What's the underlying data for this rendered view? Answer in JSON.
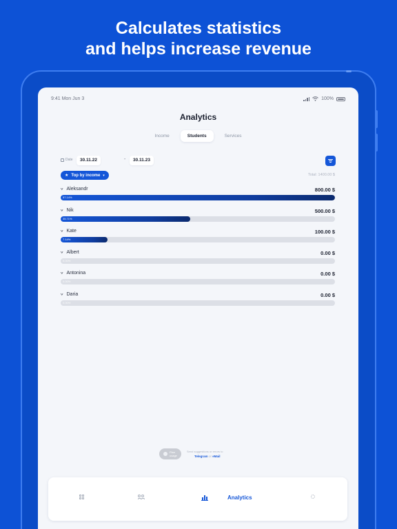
{
  "headline": {
    "line1": "Calculates statistics",
    "line2": "and helps increase revenue"
  },
  "colors": {
    "brand_blue": "#0d52d6",
    "accent": "#1456d8",
    "bar_dark": "#0b2a6e",
    "track": "#dcdfe6",
    "screen_bg": "#f4f6fa"
  },
  "status_bar": {
    "time": "9:41 Mon Jun 3",
    "battery": "100%",
    "icons": [
      "signal-icon",
      "wifi-icon",
      "battery-icon"
    ]
  },
  "page": {
    "title": "Analytics"
  },
  "tabs": [
    {
      "label": "Income",
      "active": false
    },
    {
      "label": "Students",
      "active": true
    },
    {
      "label": "Services",
      "active": false
    }
  ],
  "filters": {
    "date_label": "Date",
    "date_from": "30.11.22",
    "date_separator": "-",
    "date_to": "30.11.23",
    "filter_icon": "filter-icon"
  },
  "sort": {
    "label": "Top by income",
    "icon": "star-icon",
    "chevron": "chevron-down-icon"
  },
  "total": "Total: 1400.00 $",
  "students": [
    {
      "name": "Aleksandr",
      "amount": "800.00 $",
      "share_label": "57.14%",
      "share": 1.0
    },
    {
      "name": "Nik",
      "amount": "500.00 $",
      "share_label": "35.71%",
      "share": 0.4725
    },
    {
      "name": "Kate",
      "amount": "100.00 $",
      "share_label": "7.14%",
      "share": 0.1705
    },
    {
      "name": "Albert",
      "amount": "0.00 $",
      "share_label": "0.00%",
      "share": 0
    },
    {
      "name": "Antonina",
      "amount": "0.00 $",
      "share_label": "0.00%",
      "share": 0
    },
    {
      "name": "Daria",
      "amount": "0.00 $",
      "share_label": "0.00%",
      "share": 0
    }
  ],
  "footer": {
    "pill_line1": "Plan",
    "pill_line2": "usage",
    "note": "Send suggestions or errors to",
    "link1": "Telegram",
    "or": "or",
    "link2": "eMail"
  },
  "tab_bar": {
    "items": [
      {
        "icon": "grid-icon",
        "label": ""
      },
      {
        "icon": "people-icon",
        "label": ""
      },
      {
        "icon": "bar-chart-icon",
        "label": "Analytics"
      },
      {
        "icon": "gear-icon",
        "label": ""
      }
    ]
  }
}
